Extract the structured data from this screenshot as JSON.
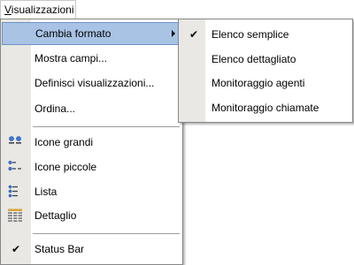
{
  "menubar": {
    "menu_first_letter": "V",
    "menu_rest": "isualizzazioni"
  },
  "main_menu": {
    "items": [
      {
        "label": "Cambia formato",
        "has_submenu": true,
        "selected": true
      },
      {
        "label": "Mostra campi..."
      },
      {
        "label": "Definisci visualizzazioni..."
      },
      {
        "label": "Ordina..."
      },
      {
        "label": "Icone grandi",
        "icon": "large-icons-icon"
      },
      {
        "label": "Icone piccole",
        "icon": "small-icons-icon"
      },
      {
        "label": "Lista",
        "icon": "list-view-icon"
      },
      {
        "label": "Dettaglio",
        "icon": "details-view-icon"
      },
      {
        "label": "Status Bar",
        "checked": true
      }
    ]
  },
  "submenu": {
    "items": [
      {
        "label": "Elenco semplice",
        "checked": true
      },
      {
        "label": "Elenco dettagliato"
      },
      {
        "label": "Monitoraggio agenti"
      },
      {
        "label": "Monitoraggio chiamate"
      }
    ]
  },
  "colors": {
    "highlight": "#a9c3e5",
    "highlight_border": "#6d93c6",
    "gutter": "#e9e8e4",
    "separator": "#9d9d9d"
  }
}
